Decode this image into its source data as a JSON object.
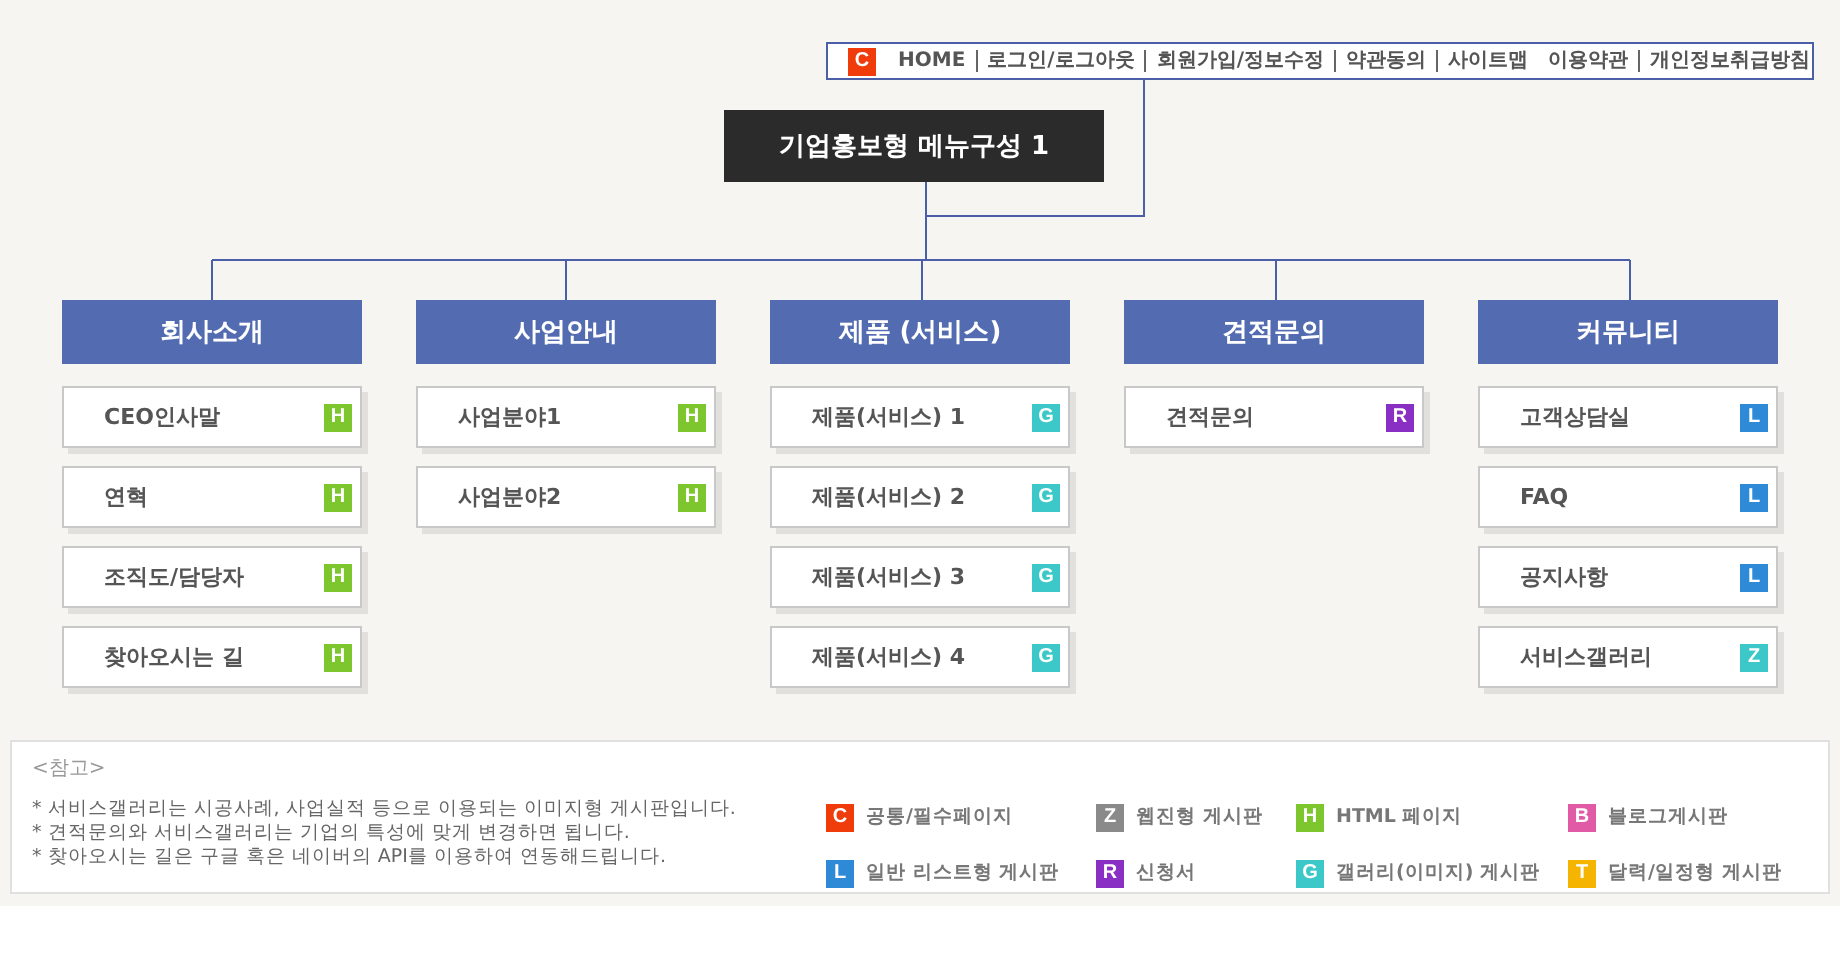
{
  "top_nav": {
    "badge": {
      "letter": "C",
      "color": "#f03c0a"
    },
    "links": [
      {
        "label": "HOME",
        "divider_before": false
      },
      {
        "label": "로그인/로그아웃",
        "divider_before": true
      },
      {
        "label": "회원가입/정보수정",
        "divider_before": true
      },
      {
        "label": "약관동의",
        "divider_before": true
      },
      {
        "label": "사이트맵",
        "divider_before": true
      },
      {
        "label": "이용약관",
        "divider_before": false
      },
      {
        "label": "개인정보취급방침",
        "divider_before": true
      }
    ]
  },
  "title": "기업홍보형 메뉴구성 1",
  "columns": [
    {
      "heading": "회사소개",
      "items": [
        {
          "label": "CEO인사말",
          "badge": {
            "letter": "H",
            "color": "#7dc62e"
          }
        },
        {
          "label": "연혁",
          "badge": {
            "letter": "H",
            "color": "#7dc62e"
          }
        },
        {
          "label": "조직도/담당자",
          "badge": {
            "letter": "H",
            "color": "#7dc62e"
          }
        },
        {
          "label": "찾아오시는 길",
          "badge": {
            "letter": "H",
            "color": "#7dc62e"
          }
        }
      ]
    },
    {
      "heading": "사업안내",
      "items": [
        {
          "label": "사업분야1",
          "badge": {
            "letter": "H",
            "color": "#7dc62e"
          }
        },
        {
          "label": "사업분야2",
          "badge": {
            "letter": "H",
            "color": "#7dc62e"
          }
        }
      ]
    },
    {
      "heading": "제품 (서비스)",
      "items": [
        {
          "label": "제품(서비스) 1",
          "badge": {
            "letter": "G",
            "color": "#3cc8c8"
          }
        },
        {
          "label": "제품(서비스) 2",
          "badge": {
            "letter": "G",
            "color": "#3cc8c8"
          }
        },
        {
          "label": "제품(서비스) 3",
          "badge": {
            "letter": "G",
            "color": "#3cc8c8"
          }
        },
        {
          "label": "제품(서비스) 4",
          "badge": {
            "letter": "G",
            "color": "#3cc8c8"
          }
        }
      ]
    },
    {
      "heading": "견적문의",
      "items": [
        {
          "label": "견적문의",
          "badge": {
            "letter": "R",
            "color": "#8a2fc4"
          }
        }
      ]
    },
    {
      "heading": "커뮤니티",
      "items": [
        {
          "label": "고객상담실",
          "badge": {
            "letter": "L",
            "color": "#2e8ad6"
          }
        },
        {
          "label": "FAQ",
          "badge": {
            "letter": "L",
            "color": "#2e8ad6"
          }
        },
        {
          "label": "공지사항",
          "badge": {
            "letter": "L",
            "color": "#2e8ad6"
          }
        },
        {
          "label": "서비스갤러리",
          "badge": {
            "letter": "Z",
            "color": "#3cc8c8"
          }
        }
      ]
    }
  ],
  "notes": {
    "heading": "<참고>",
    "lines": [
      "* 서비스갤러리는 시공사례, 사업실적 등으로 이용되는 이미지형 게시판입니다.",
      "* 견적문의와 서비스갤러리는 기업의 특성에 맞게 변경하면 됩니다.",
      "* 찾아오시는 길은 구글 혹은 네이버의 API를 이용하여 연동해드립니다."
    ],
    "legend": [
      {
        "letter": "C",
        "color": "#f03c0a",
        "label": "공통/필수페이지"
      },
      {
        "letter": "Z",
        "color": "#8a8a8a",
        "label": "웹진형 게시판"
      },
      {
        "letter": "H",
        "color": "#7dc62e",
        "label": "HTML 페이지"
      },
      {
        "letter": "B",
        "color": "#e05aa6",
        "label": "블로그게시판"
      },
      {
        "letter": "L",
        "color": "#2e8ad6",
        "label": "일반 리스트형 게시판"
      },
      {
        "letter": "R",
        "color": "#8a2fc4",
        "label": "신청서"
      },
      {
        "letter": "G",
        "color": "#3cc8c8",
        "label": "갤러리(이미지) 게시판"
      },
      {
        "letter": "T",
        "color": "#f5b400",
        "label": "달력/일정형 게시판"
      }
    ]
  }
}
